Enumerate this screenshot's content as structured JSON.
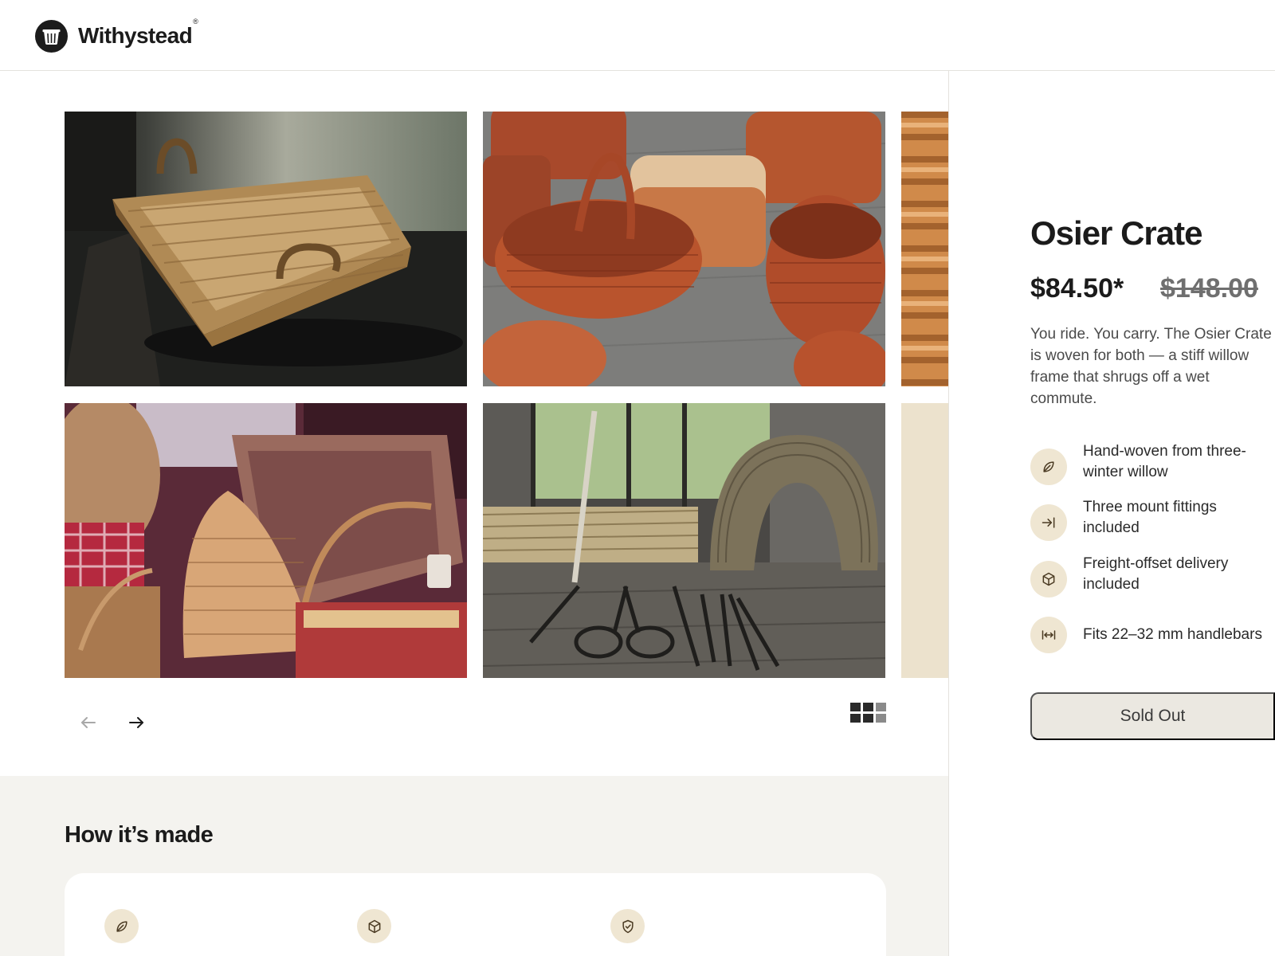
{
  "header": {
    "brand": "Withystead",
    "brand_mark": "®",
    "logo_icon": "basket-logo-icon"
  },
  "gallery": {
    "images": [
      {
        "name": "square-wicker-basket-on-table"
      },
      {
        "name": "red-willow-baskets-on-pavement"
      },
      {
        "name": "willow-weave-closeup"
      },
      {
        "name": "assorted-wicker-baskets"
      },
      {
        "name": "willow-workshop-tools"
      },
      {
        "name": "cream-placeholder"
      }
    ],
    "prev_icon": "arrow-left-icon",
    "next_icon": "arrow-right-icon",
    "grid_icon": "grid-view-icon"
  },
  "how_made": {
    "title": "How it’s made",
    "icons": [
      "leaf-icon",
      "box-icon",
      "shield-check-icon"
    ]
  },
  "product": {
    "title": "Osier Crate",
    "price": "$84.50*",
    "compare_price": "$148.00",
    "description": "You ride. You carry. The Osier Crate is woven for both — a stiff willow frame that shrugs off a wet commute.",
    "features": [
      {
        "icon": "leaf-icon",
        "line1": "Hand-woven from three-",
        "line2": "winter willow"
      },
      {
        "icon": "arrow-to-line-icon",
        "line1": "Three mount fittings",
        "line2": "included"
      },
      {
        "icon": "box-icon",
        "line1": "Freight-offset delivery",
        "line2": "included"
      },
      {
        "icon": "width-arrows-icon",
        "line1": "Fits 22–32 mm handlebars",
        "line2": ""
      }
    ],
    "cta_label": "Sold Out"
  },
  "colors": {
    "accent_bg": "#efe6d2",
    "section_bg": "#f4f3ef",
    "button_bg": "#ebe8e1"
  }
}
